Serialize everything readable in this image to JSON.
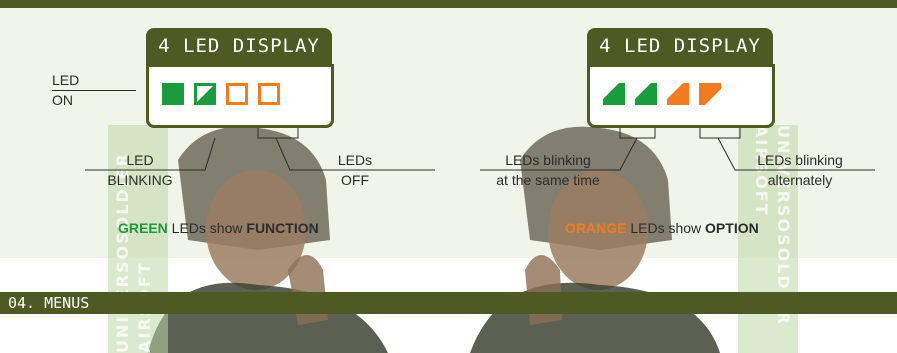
{
  "left_display": {
    "title": "4 LED DISPLAY",
    "leds": [
      {
        "state": "on",
        "color": "#1a9c3c"
      },
      {
        "state": "blinking",
        "color": "#1a9c3c"
      },
      {
        "state": "off",
        "color": "#f07c22"
      },
      {
        "state": "off",
        "color": "#f07c22"
      }
    ],
    "labels": {
      "on": [
        "LED",
        "ON"
      ],
      "blinking": [
        "LED",
        "BLINKING"
      ],
      "off": [
        "LEDs",
        "OFF"
      ]
    },
    "caption": {
      "highlight": "GREEN",
      "mid": " LEDs show ",
      "bold": "FUNCTION"
    }
  },
  "right_display": {
    "title": "4 LED DISPLAY",
    "leds": [
      {
        "state": "blinking",
        "color": "#1a9c3c"
      },
      {
        "state": "blinking",
        "color": "#1a9c3c"
      },
      {
        "state": "blinking",
        "color": "#f07c22"
      },
      {
        "state": "blinking-alt",
        "color": "#f07c22"
      }
    ],
    "labels": {
      "same_time": [
        "LEDs blinking",
        "at the same time"
      ],
      "alternately": [
        "LEDs blinking",
        "alternately"
      ]
    },
    "caption": {
      "highlight": "ORANGE",
      "mid": " LEDs show ",
      "bold": "OPTION"
    }
  },
  "strips": {
    "text_lines": [
      "UNIVERSOSOLDIER",
      "AIRSOFT"
    ]
  },
  "section": {
    "title": "04. MENUS"
  },
  "colors": {
    "green": "#1a9c3c",
    "orange": "#f07c22",
    "olive": "#4e5a23"
  }
}
